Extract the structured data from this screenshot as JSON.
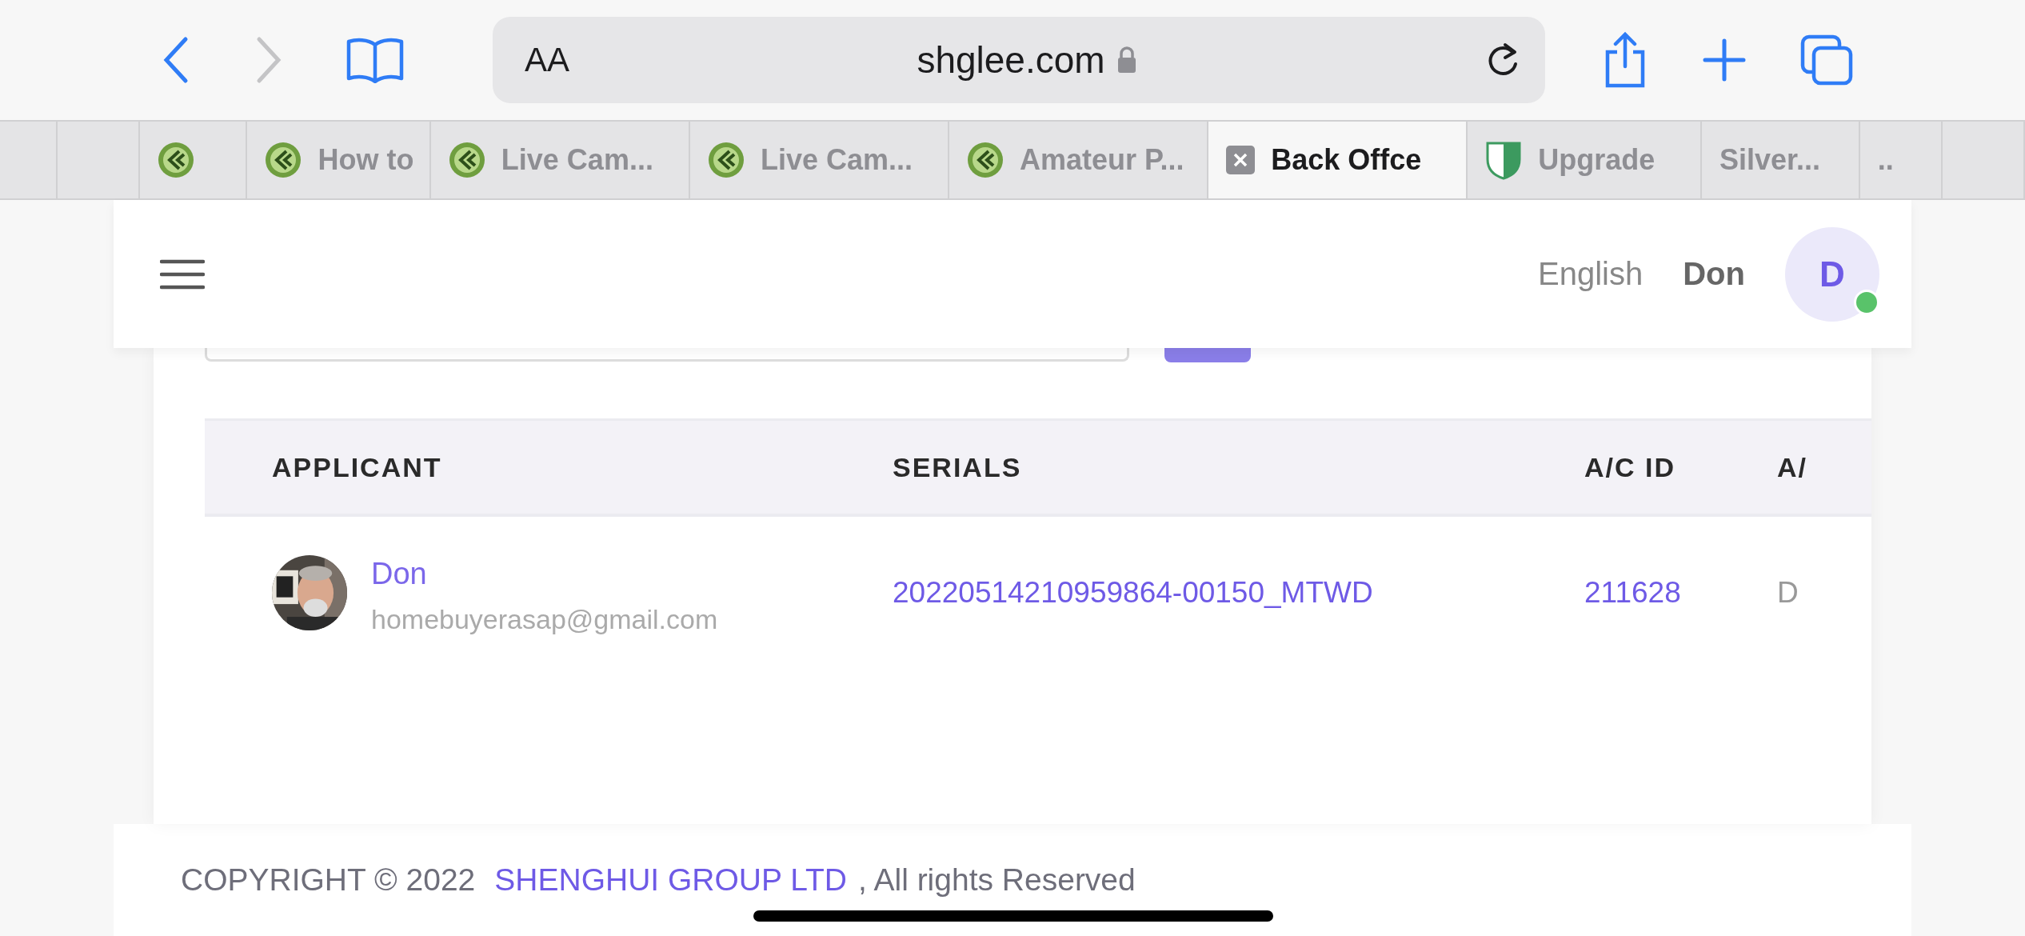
{
  "browser": {
    "text_size": "AA",
    "url": "shglee.com",
    "secure": true
  },
  "tabs": [
    {
      "kind": "plain",
      "selected": false
    },
    {
      "kind": "plain",
      "selected": false
    },
    {
      "kind": "favicon",
      "selected": false
    },
    {
      "label": "How to",
      "kind": "favicon",
      "selected": false
    },
    {
      "label": "Live Cam...",
      "kind": "favicon",
      "selected": false
    },
    {
      "label": "Live Cam...",
      "kind": "favicon",
      "selected": false
    },
    {
      "label": "Amateur P...",
      "kind": "favicon",
      "selected": false
    },
    {
      "label": "Back Offce",
      "kind": "closable",
      "selected": true
    },
    {
      "label": "Upgrade",
      "kind": "shield",
      "selected": false
    },
    {
      "label": "Silver...",
      "kind": "plain",
      "selected": false
    },
    {
      "label": "..",
      "kind": "plain",
      "selected": false
    },
    {
      "kind": "plain",
      "selected": false
    }
  ],
  "header": {
    "language": "English",
    "user": "Don",
    "avatar_letter": "D",
    "online": true
  },
  "table": {
    "columns": [
      "APPLICANT",
      "SERIALS",
      "A/C ID",
      "A/"
    ],
    "rows": [
      {
        "name": "Don",
        "email": "homebuyerasap@gmail.com",
        "serial": "20220514210959864-00150_MTWD",
        "ac_id": "211628",
        "column_4": "D"
      }
    ]
  },
  "footer": {
    "copyright": "COPYRIGHT © 2022",
    "company": "SHENGHUI GROUP LTD",
    "rights": ", All rights Reserved"
  }
}
